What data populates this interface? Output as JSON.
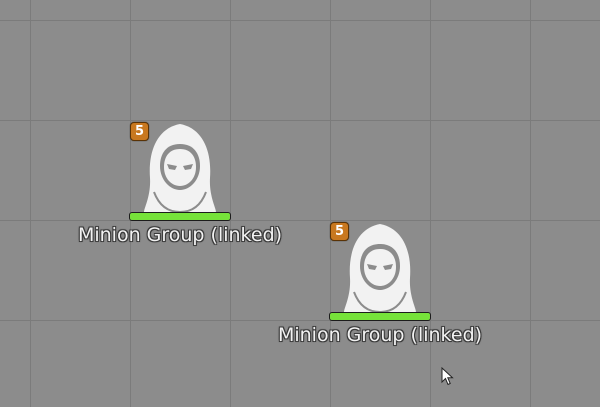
{
  "tokens": [
    {
      "name": "Minion Group (linked)",
      "badge": "5",
      "health_fraction": 1.0,
      "icon": "hooded-figure-icon"
    },
    {
      "name": "Minion Group (linked)",
      "badge": "5",
      "health_fraction": 1.0,
      "icon": "hooded-figure-icon"
    }
  ],
  "colors": {
    "background": "#8c8c8c",
    "grid": "#7b7b7b",
    "badge": "#c8781f",
    "health": "#76e23a"
  },
  "cursor": {
    "icon": "mouse-pointer-icon"
  }
}
